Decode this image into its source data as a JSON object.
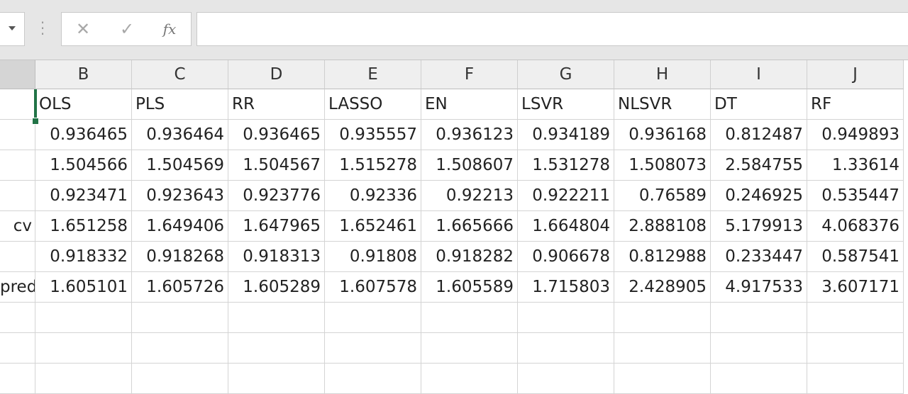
{
  "formula_bar": {
    "cancel_icon": "close-icon",
    "enter_icon": "check-icon",
    "fx_label": "fx",
    "formula_value": ""
  },
  "columns": [
    "B",
    "C",
    "D",
    "E",
    "F",
    "G",
    "H",
    "I",
    "J"
  ],
  "header_row": [
    "OLS",
    "PLS",
    "RR",
    "LASSO",
    "EN",
    "LSVR",
    "NLSVR",
    "DT",
    "RF"
  ],
  "rows": [
    {
      "label": "",
      "values": [
        "0.936465",
        "0.936464",
        "0.936465",
        "0.935557",
        "0.936123",
        "0.934189",
        "0.936168",
        "0.812487",
        "0.949893"
      ]
    },
    {
      "label": "",
      "values": [
        "1.504566",
        "1.504569",
        "1.504567",
        "1.515278",
        "1.508607",
        "1.531278",
        "1.508073",
        "2.584755",
        "1.33614"
      ]
    },
    {
      "label": "",
      "values": [
        "0.923471",
        "0.923643",
        "0.923776",
        "0.92336",
        "0.92213",
        "0.922211",
        "0.76589",
        "0.246925",
        "0.535447"
      ]
    },
    {
      "label": "cv",
      "values": [
        "1.651258",
        "1.649406",
        "1.647965",
        "1.652461",
        "1.665666",
        "1.664804",
        "2.888108",
        "5.179913",
        "4.068376"
      ]
    },
    {
      "label": "",
      "values": [
        "0.918332",
        "0.918268",
        "0.918313",
        "0.91808",
        "0.918282",
        "0.906678",
        "0.812988",
        "0.233447",
        "0.587541"
      ]
    },
    {
      "label": "pred",
      "values": [
        "1.605101",
        "1.605726",
        "1.605289",
        "1.607578",
        "1.605589",
        "1.715803",
        "2.428905",
        "4.917533",
        "3.607171"
      ]
    }
  ],
  "empty_rows": 3,
  "colors": {
    "selection": "#217346",
    "header_bg": "#efefef",
    "grid": "#d4d4d4"
  }
}
